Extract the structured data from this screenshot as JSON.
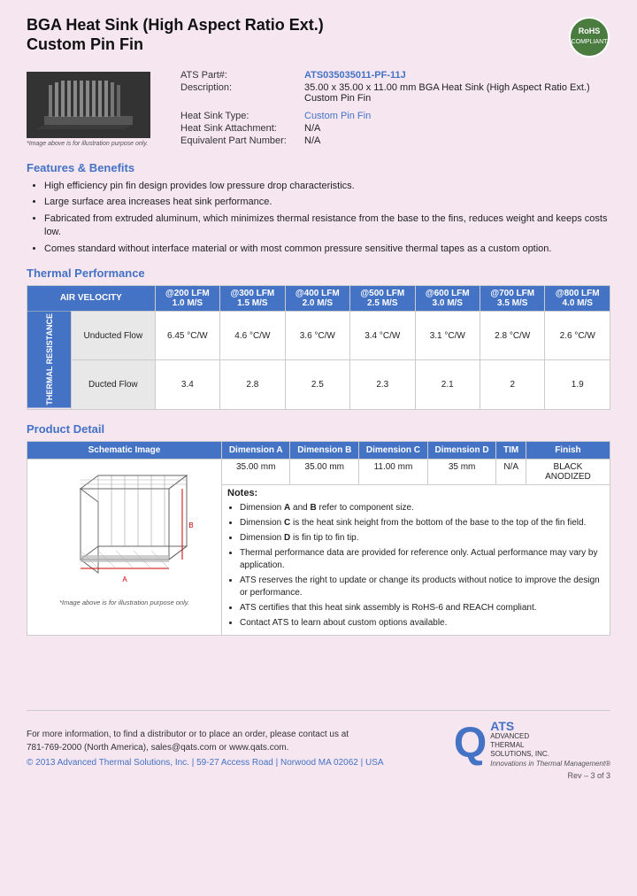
{
  "header": {
    "title_line1": "BGA Heat Sink (High Aspect Ratio Ext.)",
    "title_line2": "Custom Pin Fin"
  },
  "part_info": {
    "ats_part_label": "ATS Part#:",
    "ats_part_value": "ATS035035011-PF-11J",
    "description_label": "Description:",
    "description_value": "35.00 x 35.00 x 11.00 mm BGA Heat Sink (High Aspect Ratio Ext.) Custom Pin Fin",
    "heat_sink_type_label": "Heat Sink Type:",
    "heat_sink_type_value": "Custom Pin Fin",
    "heat_sink_attachment_label": "Heat Sink Attachment:",
    "heat_sink_attachment_value": "N/A",
    "equivalent_part_label": "Equivalent Part Number:",
    "equivalent_part_value": "N/A",
    "image_caption": "*Image above is for illustration purpose only."
  },
  "features": {
    "heading": "Features & Benefits",
    "items": [
      "High efficiency pin fin design provides low pressure drop characteristics.",
      "Large surface area increases heat sink performance.",
      "Fabricated from extruded aluminum, which minimizes thermal resistance from the base to the fins, reduces weight and keeps costs low.",
      "Comes standard without interface material or with most common pressure sensitive thermal tapes as a custom option."
    ]
  },
  "thermal_performance": {
    "heading": "Thermal Performance",
    "col_header_label": "AIR VELOCITY",
    "columns": [
      {
        "label": "@200 LFM",
        "sub": "1.0 M/S"
      },
      {
        "label": "@300 LFM",
        "sub": "1.5 M/S"
      },
      {
        "label": "@400 LFM",
        "sub": "2.0 M/S"
      },
      {
        "label": "@500 LFM",
        "sub": "2.5 M/S"
      },
      {
        "label": "@600 LFM",
        "sub": "3.0 M/S"
      },
      {
        "label": "@700 LFM",
        "sub": "3.5 M/S"
      },
      {
        "label": "@800 LFM",
        "sub": "4.0 M/S"
      }
    ],
    "row_label": "THERMAL RESISTANCE",
    "rows": [
      {
        "sub_label": "Unducted Flow",
        "values": [
          "6.45 °C/W",
          "4.6 °C/W",
          "3.6 °C/W",
          "3.4 °C/W",
          "3.1 °C/W",
          "2.8 °C/W",
          "2.6 °C/W"
        ]
      },
      {
        "sub_label": "Ducted Flow",
        "values": [
          "3.4",
          "2.8",
          "2.5",
          "2.3",
          "2.1",
          "2",
          "1.9"
        ]
      }
    ]
  },
  "product_detail": {
    "heading": "Product Detail",
    "columns": [
      "Schematic Image",
      "Dimension A",
      "Dimension B",
      "Dimension C",
      "Dimension D",
      "TIM",
      "Finish"
    ],
    "dim_values": [
      "35.00 mm",
      "35.00 mm",
      "11.00 mm",
      "35 mm",
      "N/A",
      "BLACK ANODIZED"
    ],
    "schematic_caption": "*Image above is for illustration purpose only.",
    "notes_title": "Notes:",
    "notes": [
      "Dimension A and B refer to component size.",
      "Dimension C is the heat sink height from the bottom of the base to the top of the fin field.",
      "Dimension D is fin tip to fin tip.",
      "Thermal performance data are provided for reference only. Actual performance may vary by application.",
      "ATS reserves the right to update or change its products without notice to improve the design or performance.",
      "ATS certifies that this heat sink assembly is RoHS-6 and REACH compliant.",
      "Contact ATS to learn about custom options available."
    ]
  },
  "footer": {
    "contact_line1": "For more information, to find a distributor or to place an order, please contact us at",
    "contact_line2": "781-769-2000 (North America), sales@qats.com or www.qats.com.",
    "copyright": "© 2013 Advanced Thermal Solutions, Inc. | 59-27 Access Road | Norwood MA  02062 | USA",
    "ats_name": "ATS",
    "ats_full": "ADVANCED\nTHERMAL\nSOLUTIONS, INC.",
    "ats_tagline": "Innovations in Thermal Management®",
    "rev": "Rev – 3 of 3"
  }
}
